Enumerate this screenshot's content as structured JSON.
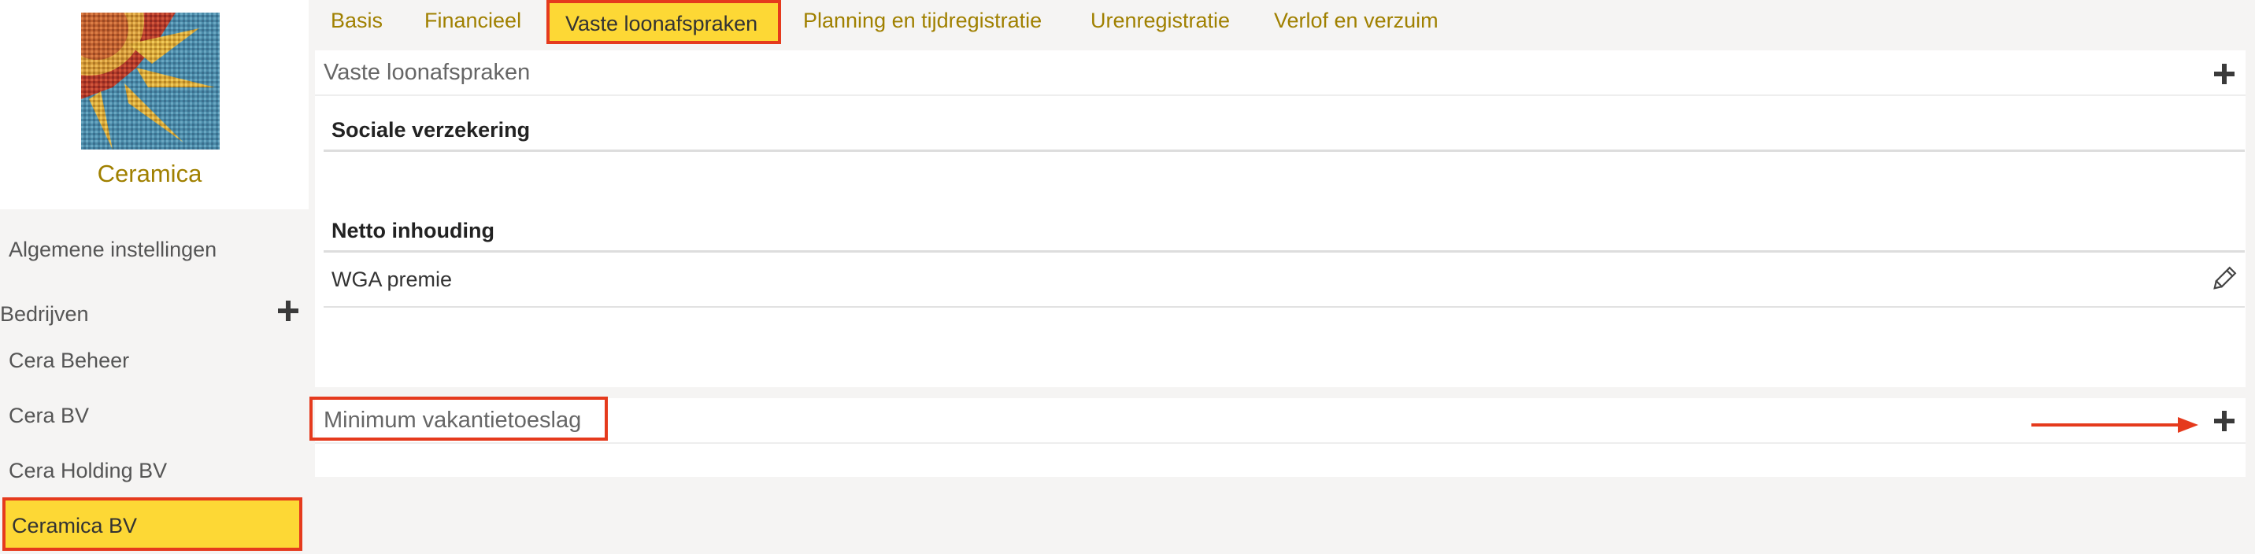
{
  "sidebar": {
    "company_name": "Ceramica",
    "general_settings": "Algemene instellingen",
    "companies_section": "Bedrijven",
    "companies": [
      "Cera Beheer",
      "Cera BV",
      "Cera Holding BV",
      "Ceramica BV"
    ],
    "active_company": "Ceramica BV"
  },
  "tabs": {
    "items": [
      "Basis",
      "Financieel",
      "Vaste loonafspraken",
      "Planning en tijdregistratie",
      "Urenregistratie",
      "Verlof en verzuim"
    ],
    "active": "Vaste loonafspraken"
  },
  "panel_fixed": {
    "title": "Vaste loonafspraken",
    "sections": [
      {
        "heading": "Sociale verzekering",
        "rows": []
      },
      {
        "heading": "Netto inhouding",
        "rows": [
          "WGA premie"
        ]
      }
    ]
  },
  "panel_minimum": {
    "title": "Minimum vakantietoeslag"
  },
  "icons": {
    "add": "plus-icon",
    "edit": "pencil-icon",
    "annotation": "arrow-right-icon"
  },
  "colors": {
    "accent_text": "#a08000",
    "highlight_fill": "#fdd835",
    "highlight_border": "#e53a1d",
    "arrow": "#e53a1d"
  }
}
